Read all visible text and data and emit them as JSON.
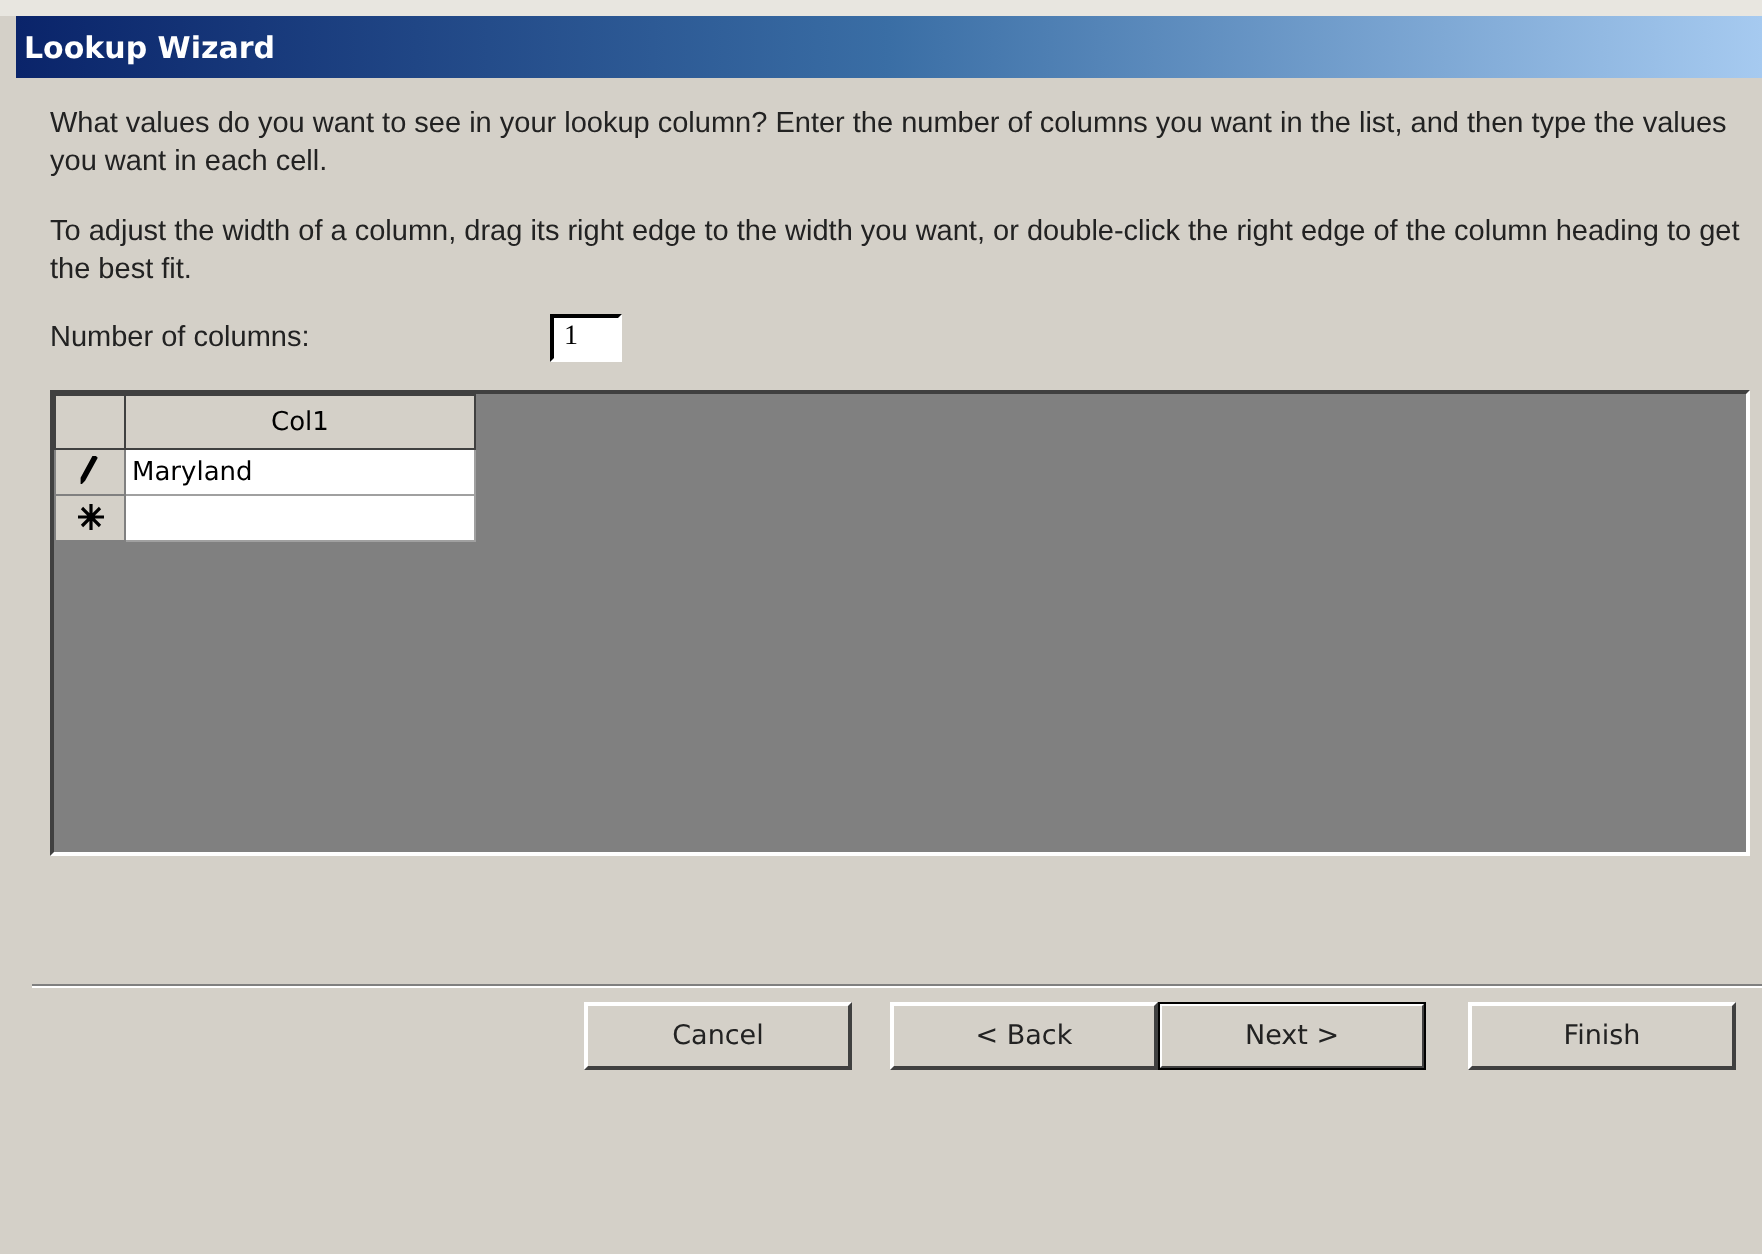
{
  "window": {
    "title": "Lookup Wizard"
  },
  "intro": "What values do you want to see in your lookup column? Enter the number of columns you want in the list, and then type the values you want in each cell.",
  "hint": "To adjust the width of a column, drag its right edge to the width you want, or double-click the right edge of the column heading to get the best fit.",
  "columns_field": {
    "label": "Number of columns:",
    "value": "1"
  },
  "grid": {
    "columns": [
      "Col1"
    ],
    "rows": [
      {
        "kind": "editing",
        "cells": [
          "Maryland"
        ]
      },
      {
        "kind": "new",
        "cells": [
          ""
        ]
      }
    ]
  },
  "buttons": [
    {
      "label": "Cancel",
      "default": false
    },
    {
      "label": "< Back",
      "default": false
    },
    {
      "label": "Next >",
      "default": true
    },
    {
      "label": "Finish",
      "default": false
    }
  ]
}
